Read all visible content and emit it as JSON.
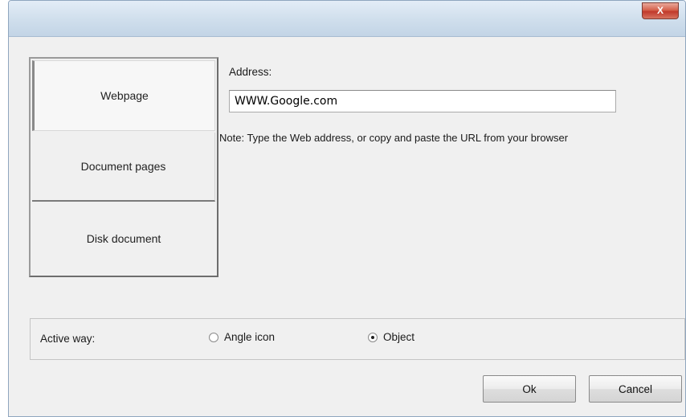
{
  "window": {
    "close_label": "X"
  },
  "tabs": [
    {
      "label": "Webpage",
      "selected": true
    },
    {
      "label": "Document pages",
      "selected": false
    },
    {
      "label": "Disk document",
      "selected": false
    }
  ],
  "address": {
    "label": "Address:",
    "value": "WWW.Google.com",
    "note": "Note: Type the Web address, or copy and paste the URL from your browser"
  },
  "active_way": {
    "label": "Active way:",
    "options": [
      {
        "label": "Angle icon",
        "checked": false
      },
      {
        "label": "Object",
        "checked": true
      }
    ]
  },
  "buttons": {
    "ok_label": "Ok",
    "cancel_label": "Cancel"
  }
}
